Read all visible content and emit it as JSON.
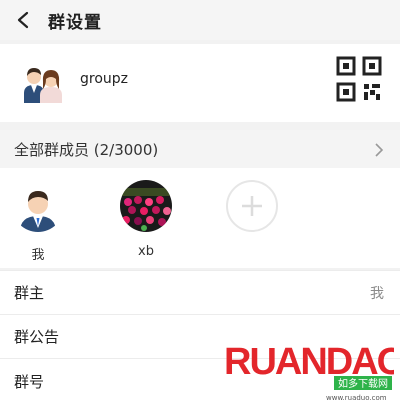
{
  "header": {
    "title": "群设置",
    "back_icon": "back-arrow-icon"
  },
  "group": {
    "name": "groupz",
    "avatar_icon": "group-avatar-icon",
    "qr_icon": "qr-code-icon"
  },
  "members": {
    "title": "全部群成员 (2/3000)",
    "chevron_icon": "chevron-right-icon",
    "list": [
      {
        "name": "我"
      },
      {
        "name": "xb"
      }
    ],
    "add_icon": "add-member-icon"
  },
  "rows": {
    "owner": {
      "label": "群主",
      "value": "我"
    },
    "notice": {
      "label": "群公告"
    },
    "id": {
      "label": "群号"
    }
  },
  "watermark": {
    "text": "RUANDAO",
    "sub": "如多下载网",
    "url": "www.ruaduo.com"
  },
  "colors": {
    "background": "#f2f2f2",
    "card": "#ffffff",
    "muted": "#8a8a8a",
    "watermark_red": "#e3262b",
    "watermark_green": "#2eb34a"
  }
}
